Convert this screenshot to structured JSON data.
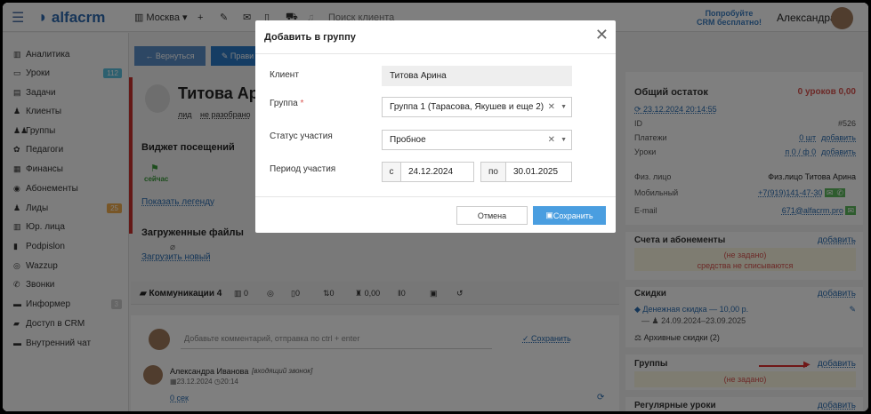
{
  "topbar": {
    "logo": "alfacrm",
    "city": "Москва ▾",
    "search": "Поиск клиента",
    "trial_line1": "Попробуйте",
    "trial_line2": "CRM бесплатно!",
    "user": "Александра"
  },
  "sidebar": {
    "items": [
      {
        "label": "Аналитика",
        "icon": "chart-icon",
        "badge": ""
      },
      {
        "label": "Уроки",
        "icon": "monitor-icon",
        "badge": "112",
        "badge_color": "#5bc0de"
      },
      {
        "label": "Задачи",
        "icon": "tasks-icon",
        "badge": ""
      },
      {
        "label": "Клиенты",
        "icon": "user-icon",
        "badge": ""
      },
      {
        "label": "Группы",
        "icon": "users-icon",
        "badge": ""
      },
      {
        "label": "Педагоги",
        "icon": "teacher-icon",
        "badge": ""
      },
      {
        "label": "Финансы",
        "icon": "money-icon",
        "badge": ""
      },
      {
        "label": "Абонементы",
        "icon": "compass-icon",
        "badge": ""
      },
      {
        "label": "Лиды",
        "icon": "user-plus-icon",
        "badge": "25",
        "badge_color": "#f0ad4e"
      },
      {
        "label": "Юр. лица",
        "icon": "building-icon",
        "badge": ""
      },
      {
        "label": "Podpislon",
        "icon": "file-icon",
        "badge": ""
      },
      {
        "label": "Wazzup",
        "icon": "whatsapp-icon",
        "badge": ""
      },
      {
        "label": "Звонки",
        "icon": "phone-icon",
        "badge": ""
      },
      {
        "label": "Информер",
        "icon": "inbox-icon",
        "badge": "3",
        "badge_color": "#ccc"
      },
      {
        "label": "Доступ в CRM",
        "icon": "lock-icon",
        "badge": ""
      },
      {
        "label": "Внутренний чат",
        "icon": "chat-icon",
        "badge": ""
      }
    ]
  },
  "main": {
    "back_btn": "← Вернуться",
    "edit_btn": "✎ Прави",
    "client_name": "Титова Ари",
    "tag1": "лид",
    "tag2": "не разобрано",
    "widget_title": "Виджет посещений",
    "now_label": "сейчас",
    "legend_link": "Показать легенду",
    "files_title": "Загруженные файлы",
    "upload_link": "Загрузить новый",
    "tabs": [
      "Коммуникации 4",
      "0",
      "0",
      "0",
      "0",
      "0,00",
      "0"
    ],
    "comment_placeholder": "Добавьте комментарий, отправка по ctrl + enter",
    "save_link": "✓ Сохранить",
    "comm_author": "Александра Иванова",
    "comm_type": "[входящий звонок]",
    "comm_date": "23.12.2024",
    "comm_time": "20:14",
    "comm_duration": "0 сек"
  },
  "right": {
    "balance_title": "Общий остаток",
    "balance_value": "0 уроков   0,00",
    "date_link": "23.12.2024 20:14:55",
    "rows": [
      {
        "label": "ID",
        "value": "#526"
      },
      {
        "label": "Платежи",
        "value": "0 шт"
      },
      {
        "label": "Уроки",
        "value": "п 0 / ф 0"
      }
    ],
    "add": "добавить",
    "type_label": "Физ. лицо",
    "type_value": "Физ.лицо Титова Арина",
    "mobile_label": "Мобильный",
    "mobile_value": "+7(919)141-47-30",
    "email_label": "E-mail",
    "email_value": "671@alfacrm.pro",
    "accounts_title": "Счета и абонементы",
    "not_set": "(не задано)",
    "no_write_off": "средства не списываются",
    "discounts_title": "Скидки",
    "discount_name": "Денежная скидка — 10,00 р.",
    "discount_period": "24.09.2024–23.09.2025",
    "archive": "Архивные скидки (2)",
    "groups_title": "Группы",
    "regular_title": "Регулярные уроки"
  },
  "modal": {
    "title": "Добавить в группу",
    "client_label": "Клиент",
    "client_value": "Титова Арина",
    "group_label": "Группа",
    "group_required": "*",
    "group_value": "Группа 1 (Тарасова, Якушев и еще 2)",
    "status_label": "Статус участия",
    "status_value": "Пробное",
    "period_label": "Период участия",
    "from_prefix": "с",
    "from_value": "24.12.2024",
    "to_prefix": "по",
    "to_value": "30.01.2025",
    "cancel": "Отмена",
    "save": "Сохранить"
  }
}
